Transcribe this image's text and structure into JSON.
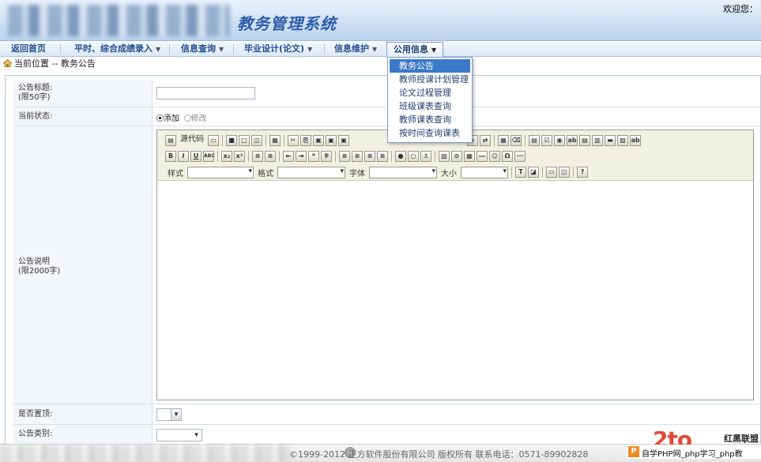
{
  "header": {
    "system_title": "教务管理系统",
    "welcome": "欢迎您："
  },
  "menu": {
    "items": [
      {
        "label": "返回首页",
        "has_caret": false
      },
      {
        "label": "平时、综合成绩录入",
        "has_caret": true
      },
      {
        "label": "信息查询",
        "has_caret": true
      },
      {
        "label": "毕业设计(论文)",
        "has_caret": true
      },
      {
        "label": "信息维护",
        "has_caret": true
      },
      {
        "label": "公用信息",
        "has_caret": true,
        "active": true
      }
    ],
    "caret": "▼"
  },
  "dropdown": {
    "items": [
      "教务公告",
      "教师授课计划管理",
      "论文过程管理",
      "班级课表查询",
      "教师课表查询",
      "按时间查询课表"
    ],
    "highlighted_index": 0
  },
  "breadcrumb": {
    "text": "当前位置 -- 教务公告"
  },
  "form": {
    "title_label": "公告标题:",
    "title_hint": "(限50字)",
    "title_value": "",
    "status_label": "当前状态:",
    "status_options": [
      "添加",
      "修改"
    ],
    "status_selected": "添加",
    "desc_label": "公告说明",
    "desc_hint": "(限2000字)",
    "pin_label": "是否置顶:",
    "category_label": "公告类别:"
  },
  "editor": {
    "source_label": "源代码",
    "style_label": "样式",
    "format_label": "格式",
    "font_label": "字体",
    "size_label": "大小"
  },
  "footer": {
    "copyright": "©1999-2012   正方软件股份有限公司 版权所有  联系电话：0571-89902828"
  },
  "watermark": {
    "brand": "红黑联盟",
    "bar_text": "自学PHP网_php学习_php教"
  },
  "colors": {
    "title_blue": "#2c5ea8",
    "menu_text": "#1f4f8f",
    "highlight": "#3b78c8",
    "watermark_red": "#e14a3a"
  }
}
